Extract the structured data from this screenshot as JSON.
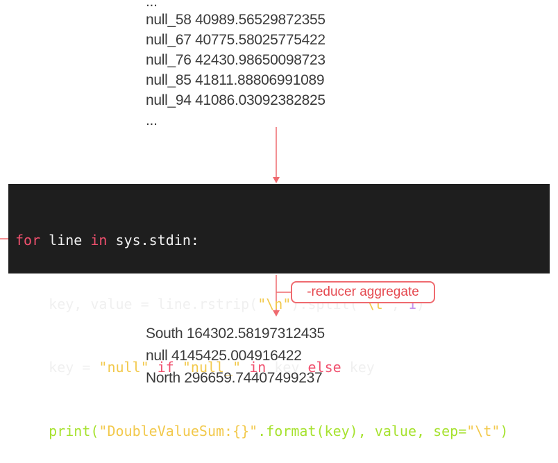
{
  "input": {
    "ellipsis_top": "...",
    "lines": [
      "null_58 40989.56529872355",
      "null_67 40775.58025775422",
      "null_76 42430.98650098723",
      "null_85 41811.88806991089",
      "null_94 41086.03092382825"
    ],
    "ellipsis_bottom": "..."
  },
  "code": {
    "line1": {
      "kw1": "for",
      "t1": " line ",
      "kw2": "in",
      "t2": " sys.stdin:"
    },
    "line2": {
      "indent": "    ",
      "t1": "key, value = line.rstrip(",
      "s1": "\"\\n\"",
      "t2": ").split(",
      "s2": "\"\\t\"",
      "t3": ", ",
      "n1": "1",
      "t4": ")"
    },
    "line3": {
      "indent": "    ",
      "t1": "key = ",
      "s1": "\"null\"",
      "t2": " ",
      "kw1": "if",
      "t3": " ",
      "s2": "\"null_\"",
      "t4": " ",
      "kw2": "in",
      "t5": " key ",
      "kw3": "else",
      "t6": " key"
    },
    "line4": {
      "indent": "    ",
      "f1": "print(",
      "s1": "\"DoubleValueSum:{}\"",
      "t1": ".",
      "f2": "format",
      "t2": "(key), value, sep=",
      "s2": "\"\\t\"",
      "t3": ")"
    }
  },
  "annotation": {
    "label": "-reducer aggregate"
  },
  "output": {
    "lines": [
      "South 164302.58197312435",
      "null 4145425.004916422",
      "North 296659.74407499237"
    ]
  },
  "colors": {
    "arrow": "#ef6a6f",
    "code_background": "#1e1e1e",
    "keyword": "#f0506e",
    "string": "#f2c94c",
    "function": "#a6e22e",
    "number": "#c792ea"
  }
}
